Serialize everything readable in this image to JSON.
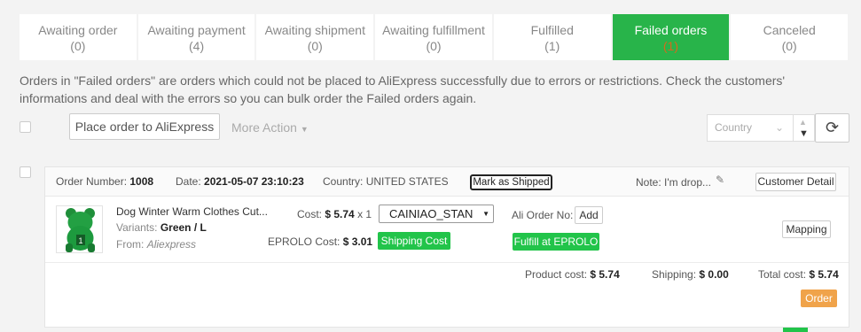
{
  "tabs": [
    {
      "label": "Awaiting order",
      "count": "(0)"
    },
    {
      "label": "Awaiting payment",
      "count": "(4)"
    },
    {
      "label": "Awaiting shipment",
      "count": "(0)"
    },
    {
      "label": "Awaiting fulfillment",
      "count": "(0)"
    },
    {
      "label": "Fulfilled",
      "count": "(1)"
    },
    {
      "label": "Failed orders",
      "count": "(1)",
      "active": true
    },
    {
      "label": "Canceled",
      "count": "(0)"
    }
  ],
  "notice": "Orders in \"Failed orders\" are orders which could not be placed to AliExpress successfully due to errors or restrictions. Check the customers' informations and deal with the errors so you can bulk order the Failed orders again.",
  "toolbar": {
    "place_order_label": "Place order to AliExpress",
    "more_action_label": "More Action",
    "country_placeholder": "Country"
  },
  "order": {
    "number_label": "Order Number:",
    "number": "1008",
    "date_label": "Date:",
    "date": "2021-05-07 23:10:23",
    "country_label": "Country:",
    "country": "UNITED STATES",
    "mark_shipped_label": "Mark as Shipped",
    "note_label": "Note:",
    "note": "I'm drop...",
    "customer_detail_label": "Customer Detail",
    "product": {
      "title": "Dog Winter Warm Clothes Cut...",
      "variants_label": "Variants:",
      "variants": "Green / L",
      "from_label": "From:",
      "from": "Aliexpress",
      "cost_label": "Cost:",
      "cost": "$ 5.74",
      "qty": "x 1",
      "eprolo_cost_label": "EPROLO Cost:",
      "eprolo_cost": "$ 3.01",
      "shipping_method": "CAINIAO_STAN",
      "shipping_cost_label": "Shipping Cost",
      "ali_order_label": "Ali Order No:",
      "add_label": "Add",
      "fulfill_label": "Fulfill at EPROLO",
      "mapping_label": "Mapping"
    },
    "summary": {
      "product_cost_label": "Product cost:",
      "product_cost": "$ 5.74",
      "shipping_label": "Shipping:",
      "shipping": "$ 0.00",
      "total_label": "Total cost:",
      "total": "$ 5.74",
      "order_label": "Order"
    }
  },
  "colors": {
    "accent_green": "#28b44a",
    "count_orange": "#d46a1e",
    "order_orange": "#f0a34a"
  }
}
